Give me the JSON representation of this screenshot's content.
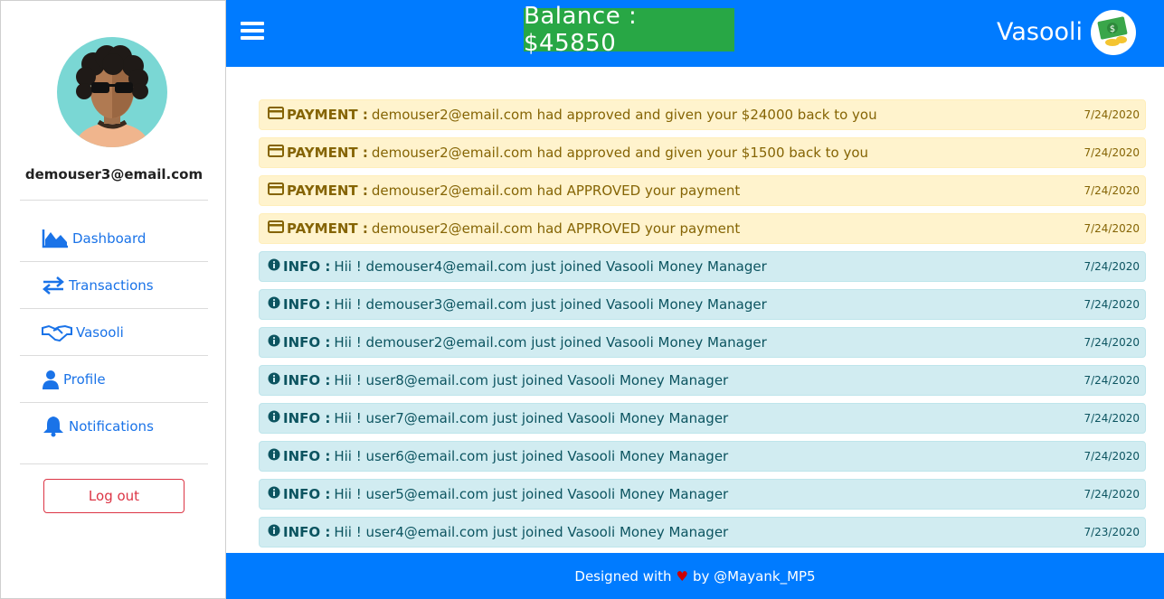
{
  "sidebar": {
    "username": "demouser3@email.com",
    "nav": [
      {
        "label": "Dashboard",
        "icon": "chart-area-icon"
      },
      {
        "label": "Transactions",
        "icon": "exchange-icon"
      },
      {
        "label": "Vasooli",
        "icon": "handshake-icon"
      },
      {
        "label": "Profile",
        "icon": "user-icon"
      },
      {
        "label": "Notifications",
        "icon": "bell-icon"
      }
    ],
    "logout_label": "Log out"
  },
  "header": {
    "balance": "Balance : $45850",
    "brand": "Vasooli"
  },
  "notifications": [
    {
      "type": "payment",
      "kind": "PAYMENT :",
      "message": "demouser2@email.com had approved and given your $24000 back to you",
      "date": "7/24/2020"
    },
    {
      "type": "payment",
      "kind": "PAYMENT :",
      "message": "demouser2@email.com had approved and given your $1500 back to you",
      "date": "7/24/2020"
    },
    {
      "type": "payment",
      "kind": "PAYMENT :",
      "message": "demouser2@email.com had APPROVED your payment",
      "date": "7/24/2020"
    },
    {
      "type": "payment",
      "kind": "PAYMENT :",
      "message": "demouser2@email.com had APPROVED your payment",
      "date": "7/24/2020"
    },
    {
      "type": "info",
      "kind": "INFO :",
      "message": "Hii ! demouser4@email.com just joined Vasooli Money Manager",
      "date": "7/24/2020"
    },
    {
      "type": "info",
      "kind": "INFO :",
      "message": "Hii ! demouser3@email.com just joined Vasooli Money Manager",
      "date": "7/24/2020"
    },
    {
      "type": "info",
      "kind": "INFO :",
      "message": "Hii ! demouser2@email.com just joined Vasooli Money Manager",
      "date": "7/24/2020"
    },
    {
      "type": "info",
      "kind": "INFO :",
      "message": "Hii ! user8@email.com just joined Vasooli Money Manager",
      "date": "7/24/2020"
    },
    {
      "type": "info",
      "kind": "INFO :",
      "message": "Hii ! user7@email.com just joined Vasooli Money Manager",
      "date": "7/24/2020"
    },
    {
      "type": "info",
      "kind": "INFO :",
      "message": "Hii ! user6@email.com just joined Vasooli Money Manager",
      "date": "7/24/2020"
    },
    {
      "type": "info",
      "kind": "INFO :",
      "message": "Hii ! user5@email.com just joined Vasooli Money Manager",
      "date": "7/24/2020"
    },
    {
      "type": "info",
      "kind": "INFO :",
      "message": "Hii ! user4@email.com just joined Vasooli Money Manager",
      "date": "7/23/2020"
    }
  ],
  "footer": {
    "prefix": "Designed with",
    "heart": "♥",
    "suffix": "by @Mayank_MP5"
  },
  "colors": {
    "primary": "#007bff",
    "balance": "#28a745",
    "payment_bg": "#fff3cd",
    "info_bg": "#d1ecf1",
    "logout": "#dc3545"
  }
}
